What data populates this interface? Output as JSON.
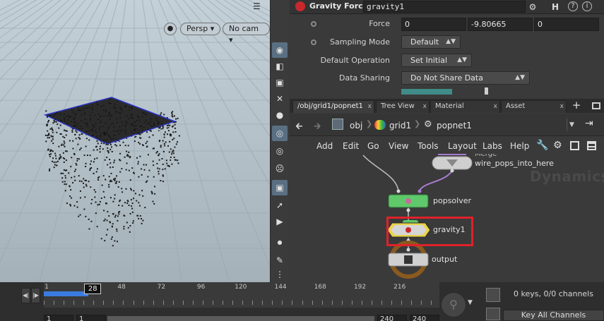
{
  "viewport": {
    "camera_menu": "Persp",
    "cam_menu": "No cam",
    "arrow_suffix": "▾",
    "toolbar_icons": [
      "eye-icon",
      "display-icon",
      "lock-icon",
      "x-icon",
      "shading-icon",
      "light-icon",
      "bulb-icon",
      "skull-icon",
      "snapshot-icon",
      "wand-icon",
      "wand-play-icon",
      "dot-icon",
      "pen-icon"
    ]
  },
  "params": {
    "node_type": "Gravity Force",
    "node_name": "gravity1",
    "help_icon": "H",
    "info_icon": "?",
    "info2_icon": "i",
    "rows": [
      {
        "label": "Force",
        "values": [
          "0",
          "-9.80665",
          "0"
        ]
      },
      {
        "label": "Sampling Mode",
        "menu": "Default"
      },
      {
        "label": "Default Operation",
        "menu": "Set Initial"
      },
      {
        "label": "Data Sharing",
        "menu": "Do Not Share Data"
      }
    ]
  },
  "network": {
    "tabs": [
      "/obj/grid1/popnet1",
      "Tree View",
      "Material Palette",
      "Asset Browser"
    ],
    "tab_close": "x",
    "new_tab": "+",
    "path": [
      "obj",
      "grid1",
      "popnet1"
    ],
    "menus": [
      "Add",
      "Edit",
      "Go",
      "View",
      "Tools",
      "Layout",
      "Labs",
      "Help"
    ],
    "context_label": "Dynamics",
    "nodes": {
      "merge_type": "Merge",
      "merge_name": "wire_pops_into_here",
      "solver": "popsolver",
      "gravity": "gravity1",
      "output": "output"
    }
  },
  "timeline": {
    "tick_labels": [
      "1",
      "48",
      "72",
      "96",
      "120",
      "144",
      "168",
      "192",
      "216"
    ],
    "current_frame": "28",
    "start_a": "1",
    "start_b": "1",
    "end_a": "240",
    "end_b": "240",
    "keys_status": "0 keys, 0/0 channels",
    "key_all": "Key All Channels"
  },
  "colors": {
    "highlight": "#e0212a",
    "solver_node": "#5fc86a",
    "timeline_range": "#3a7be0",
    "grid_edge": "#2a33c8"
  }
}
